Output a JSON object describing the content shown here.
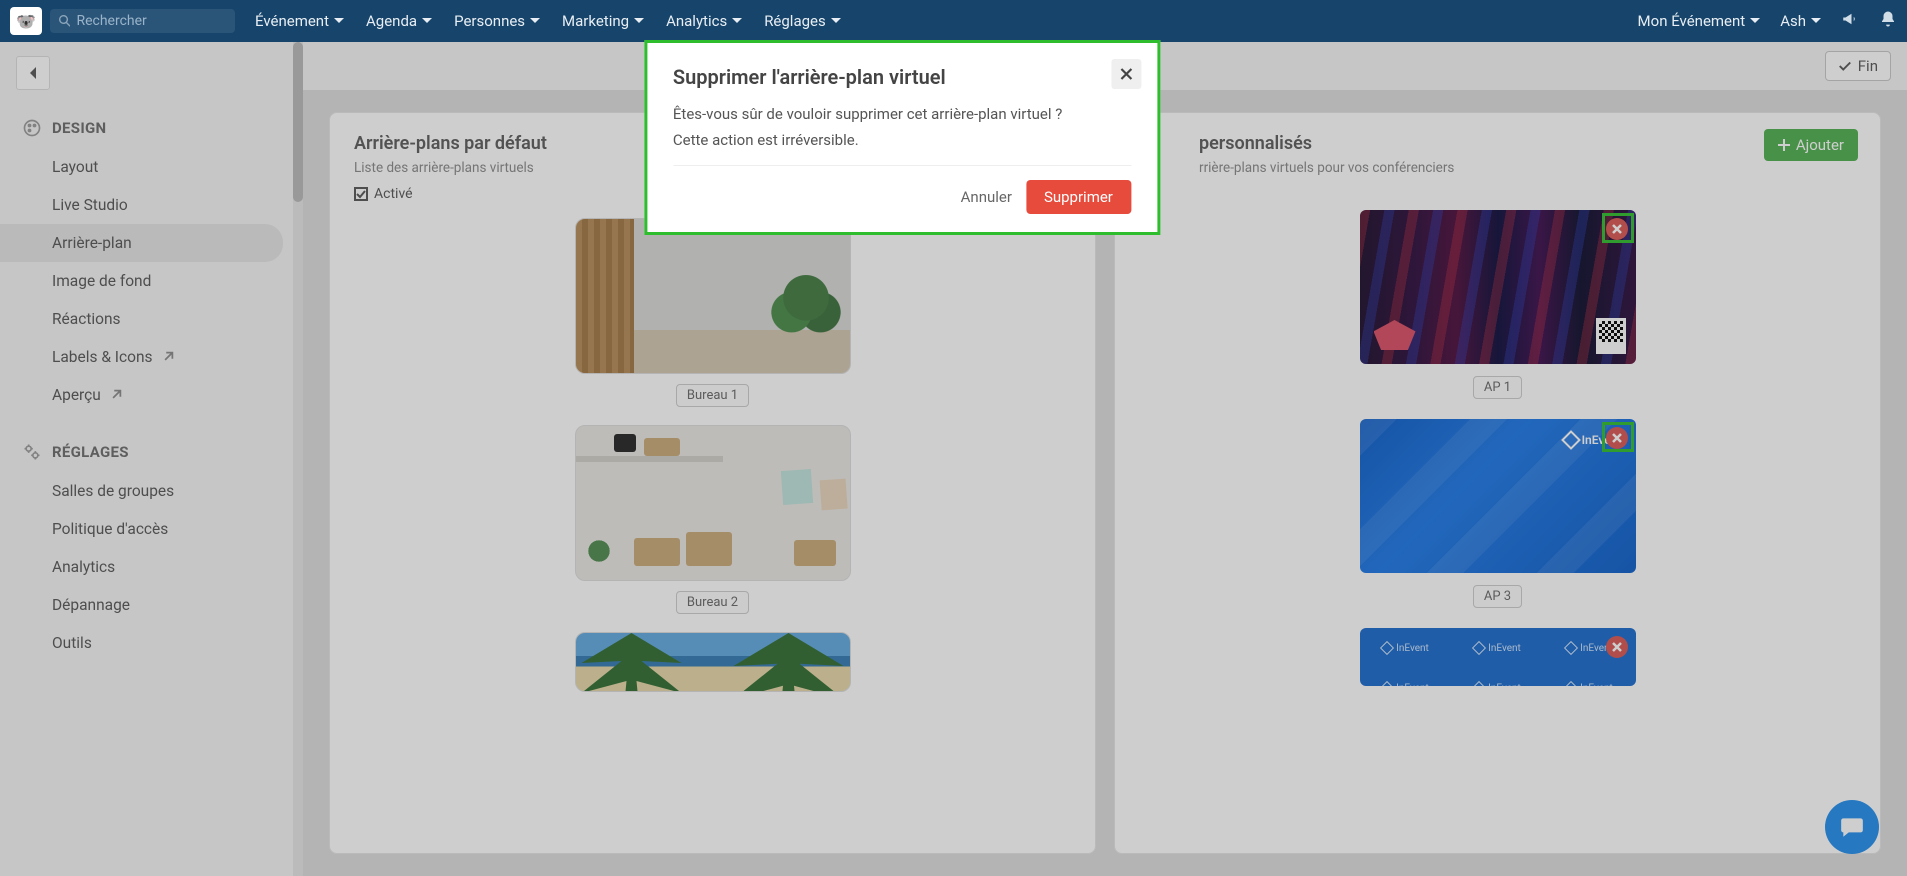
{
  "search": {
    "placeholder": "Rechercher"
  },
  "nav": {
    "items": [
      "Événement",
      "Agenda",
      "Personnes",
      "Marketing",
      "Analytics",
      "Réglages"
    ],
    "event_name": "Mon Événement",
    "user": "Ash"
  },
  "toolbar": {
    "fin": "Fin"
  },
  "sidebar": {
    "section_design": "DESIGN",
    "section_reglages": "RÉGLAGES",
    "design_items": [
      "Layout",
      "Live Studio",
      "Arrière-plan",
      "Image de fond",
      "Réactions",
      "Labels & Icons",
      "Aperçu"
    ],
    "reglages_items": [
      "Salles de groupes",
      "Politique d'accès",
      "Analytics",
      "Dépannage",
      "Outils"
    ]
  },
  "panels": {
    "defaults": {
      "title": "Arrière-plans par défaut",
      "subtitle": "Liste des arrière-plans virtuels",
      "enabled_label": "Activé",
      "items": [
        "Bureau 1",
        "Bureau 2"
      ]
    },
    "custom": {
      "title_suffix": "personnalisés",
      "subtitle_suffix": "rrière-plans virtuels pour vos conférenciers",
      "add_label": "Ajouter",
      "items": [
        "AP 1",
        "AP 3"
      ],
      "brand_text": "InEvent"
    }
  },
  "modal": {
    "title": "Supprimer l'arrière-plan virtuel",
    "line1": "Êtes-vous sûr de vouloir supprimer cet arrière-plan virtuel ?",
    "line2": "Cette action est irréversible.",
    "cancel": "Annuler",
    "confirm": "Supprimer"
  }
}
